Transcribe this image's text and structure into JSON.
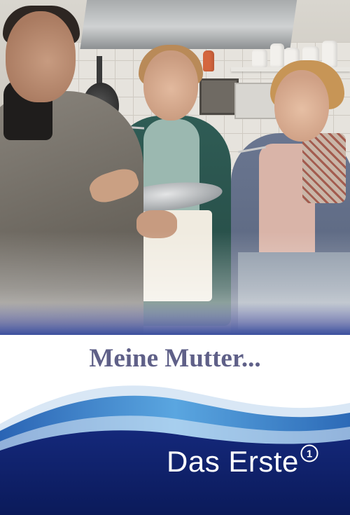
{
  "poster": {
    "title": "Meine Mutter...",
    "broadcaster": {
      "name": "Das Erste",
      "logo_glyph": "1"
    }
  },
  "colors": {
    "title": "#5f6088",
    "footer_navy": "#0d1e63",
    "wave_light": "#3e8fd0"
  },
  "icons": [
    "ard-one-logo-icon"
  ]
}
